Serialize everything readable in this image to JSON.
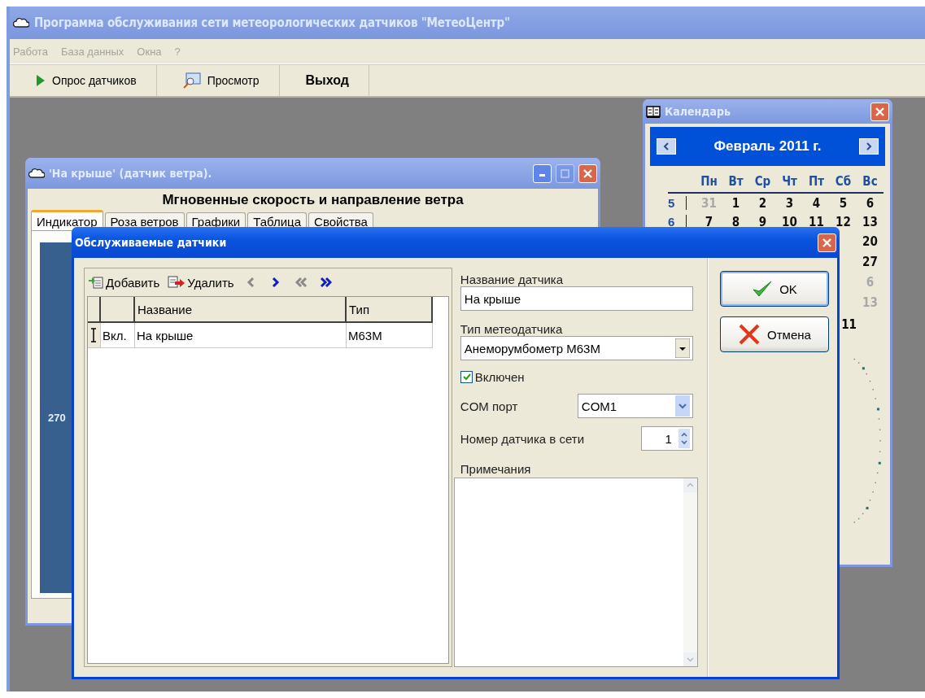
{
  "main_window": {
    "title": "Программа обслуживания сети метеорологических датчиков \"МетеоЦентр\"",
    "menu": [
      {
        "label": "Работа",
        "disabled": true
      },
      {
        "label": "База данных",
        "disabled": true
      },
      {
        "label": "Окна",
        "disabled": true
      },
      {
        "label": "?",
        "disabled": true
      }
    ],
    "toolbar": [
      {
        "label": "Опрос датчиков",
        "kind": "play"
      },
      {
        "label": "Просмотр",
        "kind": "view"
      },
      {
        "label": "Выход",
        "kind": "text"
      }
    ]
  },
  "sensor_window": {
    "title": "'На крыше' (датчик ветра).",
    "heading": "Мгновенные скорость и направление ветра",
    "tabs": [
      {
        "label": "Индикатор",
        "selected": true
      },
      {
        "label": "Роза ветров",
        "selected": false
      },
      {
        "label": "Графики",
        "selected": false
      },
      {
        "label": "Таблица",
        "selected": false
      },
      {
        "label": "Свойства",
        "selected": false
      }
    ],
    "dial_label": "270"
  },
  "calendar": {
    "title": "Календарь",
    "month": "Февраль 2011 г.",
    "weekdays": [
      "Пн",
      "Вт",
      "Ср",
      "Чт",
      "Пт",
      "Сб",
      "Вс"
    ],
    "rows": [
      {
        "week": "5",
        "days": [
          {
            "text": "31",
            "other_month": true
          },
          {
            "text": "1",
            "other_month": false
          },
          {
            "text": "2",
            "other_month": false
          },
          {
            "text": "3",
            "other_month": false
          },
          {
            "text": "4",
            "other_month": false
          },
          {
            "text": "5",
            "other_month": false
          },
          {
            "text": "6",
            "other_month": false
          }
        ]
      },
      {
        "week": "6",
        "days": [
          {
            "text": "7",
            "other_month": false
          },
          {
            "text": "8",
            "other_month": false
          },
          {
            "text": "9",
            "other_month": false
          },
          {
            "text": "10",
            "other_month": false
          },
          {
            "text": "11",
            "other_month": false
          },
          {
            "text": "12",
            "other_month": false
          },
          {
            "text": "13",
            "other_month": false
          }
        ]
      },
      {
        "days": [
          {
            "text": "20",
            "other_month": false
          }
        ]
      },
      {
        "days": [
          {
            "text": "27",
            "other_month": false
          }
        ]
      },
      {
        "days": [
          {
            "text": "6",
            "other_month": true
          }
        ]
      },
      {
        "days": [
          {
            "text": "13",
            "other_month": true
          }
        ]
      }
    ],
    "footer": "11"
  },
  "dialog": {
    "title": "Обслуживаемые датчики",
    "toolbar": [
      {
        "label": "Добавить",
        "kind": "add"
      },
      {
        "label": "Удалить",
        "kind": "delete"
      }
    ],
    "nav": [
      {
        "kind": "prev",
        "disabled": true
      },
      {
        "kind": "next",
        "disabled": false
      },
      {
        "kind": "first",
        "disabled": true
      },
      {
        "kind": "last",
        "disabled": false
      }
    ],
    "table": {
      "columns": [
        "Название",
        "Тип"
      ],
      "rows": [
        {
          "enabled": "Вкл.",
          "name": "На крыше",
          "type": "M63M",
          "current": true
        }
      ]
    },
    "name_label": "Название датчика",
    "name_value": "На крыше",
    "type_label": "Тип метеодатчика",
    "type_value": "Анеморумбометр M63M",
    "enabled": {
      "label": "Включен",
      "checked": true
    },
    "com_label": "COM порт",
    "com_value": "COM1",
    "number_label": "Номер датчика в сети",
    "number_value": "1",
    "notes_label": "Примечания",
    "buttons": [
      {
        "label": "OK",
        "kind": "ok"
      },
      {
        "label": "Отмена",
        "kind": "cancel"
      }
    ]
  }
}
